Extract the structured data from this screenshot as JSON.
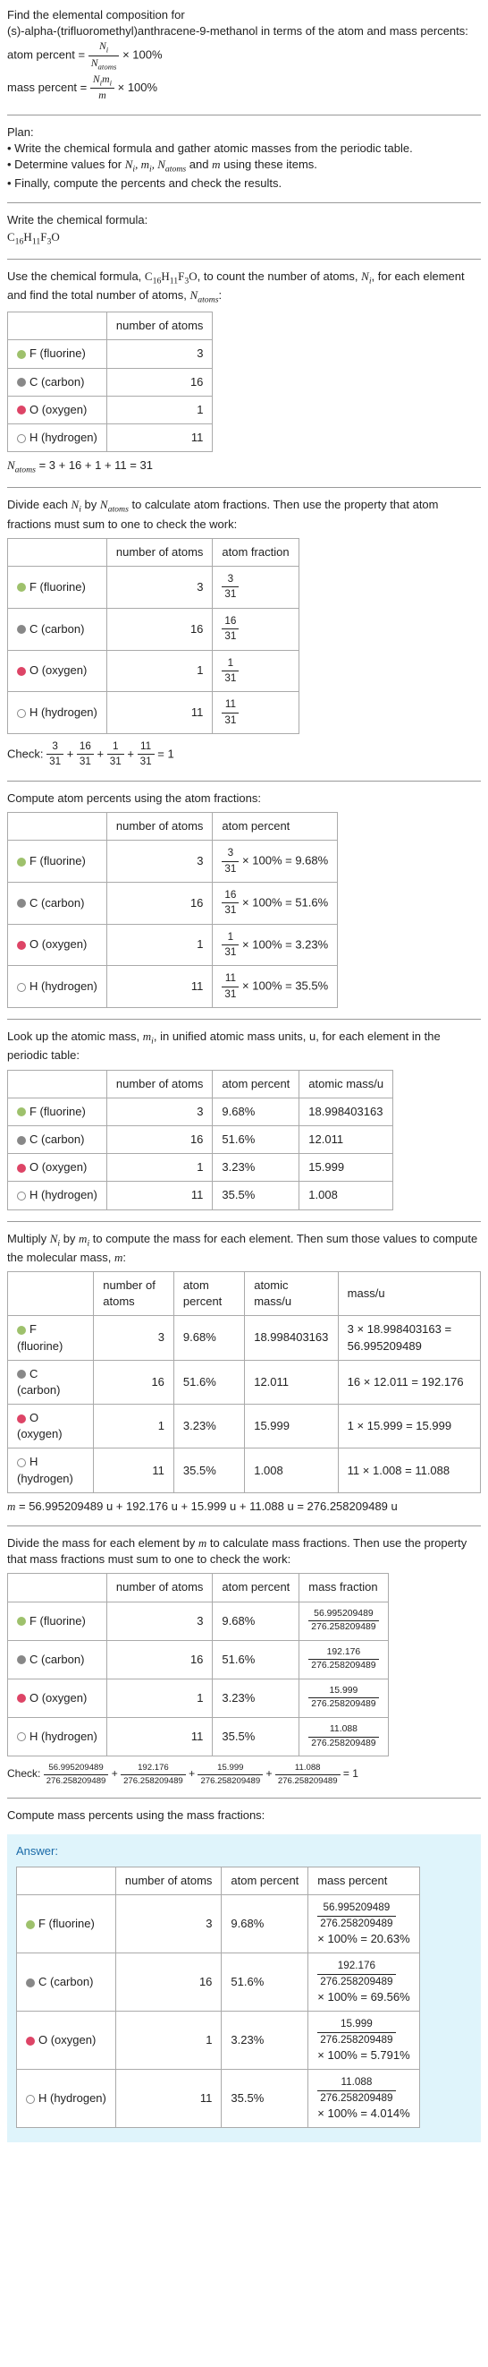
{
  "intro": {
    "title_line1": "Find the elemental composition for",
    "title_line2": "(s)-alpha-(trifluoromethyl)anthracene-9-methanol in terms of the atom and mass percents:",
    "atom_percent_label": "atom percent =",
    "atom_percent_frac_num": "N_i",
    "atom_percent_frac_den": "N_atoms",
    "times100": "× 100%",
    "mass_percent_label": "mass percent =",
    "mass_percent_frac_num": "N_i m_i",
    "mass_percent_frac_den": "m"
  },
  "plan": {
    "heading": "Plan:",
    "b1": "• Write the chemical formula and gather atomic masses from the periodic table.",
    "b2_pre": "• Determine values for ",
    "b2_items": "N_i, m_i, N_atoms and m",
    "b2_post": " using these items.",
    "b3": "• Finally, compute the percents and check the results."
  },
  "formula_section": {
    "heading": "Write the chemical formula:",
    "formula": "C₁₆H₁₁F₃O"
  },
  "count_section": {
    "text_pre": "Use the chemical formula, ",
    "text_formula": "C₁₆H₁₁F₃O",
    "text_mid": ", to count the number of atoms, ",
    "text_ni": "N_i",
    "text_post": ", for each element and find the total number of atoms, ",
    "text_natoms": "N_atoms",
    "colon": ":",
    "col_noa": "number of atoms",
    "elements": {
      "f_name": "F (fluorine)",
      "c_name": "C (carbon)",
      "o_name": "O (oxygen)",
      "h_name": "H (hydrogen)"
    },
    "n_f": "3",
    "n_c": "16",
    "n_o": "1",
    "n_h": "11",
    "natoms_line": "N_atoms = 3 + 16 + 1 + 11 = 31"
  },
  "atomfrac_section": {
    "text": "Divide each N_i by N_atoms to calculate atom fractions. Then use the property that atom fractions must sum to one to check the work:",
    "col_noa": "number of atoms",
    "col_af": "atom fraction",
    "af_f_num": "3",
    "af_f_den": "31",
    "af_c_num": "16",
    "af_c_den": "31",
    "af_o_num": "1",
    "af_o_den": "31",
    "af_h_num": "11",
    "af_h_den": "31",
    "check_label": "Check: ",
    "check_eq": " = 1"
  },
  "atompct_section": {
    "text": "Compute atom percents using the atom fractions:",
    "col_noa": "number of atoms",
    "col_ap": "atom percent",
    "ap_f": " × 100% = 9.68%",
    "ap_c": " × 100% = 51.6%",
    "ap_o": " × 100% = 3.23%",
    "ap_h": " × 100% = 35.5%"
  },
  "atomicmass_section": {
    "text_pre": "Look up the atomic mass, ",
    "text_mi": "m_i",
    "text_post": ", in unified atomic mass units, u, for each element in the periodic table:",
    "col_noa": "number of atoms",
    "col_ap": "atom percent",
    "col_am": "atomic mass/u",
    "ap_f": "9.68%",
    "ap_c": "51.6%",
    "ap_o": "3.23%",
    "ap_h": "35.5%",
    "am_f": "18.998403163",
    "am_c": "12.011",
    "am_o": "15.999",
    "am_h": "1.008"
  },
  "massmult_section": {
    "text": "Multiply N_i by m_i to compute the mass for each element. Then sum those values to compute the molecular mass, m:",
    "col_noa": "number of atoms",
    "col_ap": "atom percent",
    "col_am": "atomic mass/u",
    "col_mass": "mass/u",
    "mass_f": "3 × 18.998403163 = 56.995209489",
    "mass_c": "16 × 12.011 = 192.176",
    "mass_o": "1 × 15.999 = 15.999",
    "mass_h": "11 × 1.008 = 11.088",
    "m_line": "m = 56.995209489 u + 192.176 u + 15.999 u + 11.088 u = 276.258209489 u"
  },
  "massfrac_section": {
    "text": "Divide the mass for each element by m to calculate mass fractions. Then use the property that mass fractions must sum to one to check the work:",
    "col_noa": "number of atoms",
    "col_ap": "atom percent",
    "col_mf": "mass fraction",
    "mf_f_num": "56.995209489",
    "mf_den": "276.258209489",
    "mf_c_num": "192.176",
    "mf_o_num": "15.999",
    "mf_h_num": "11.088",
    "check_label": "Check: ",
    "check_eq": " = 1"
  },
  "masspct_section": {
    "text": "Compute mass percents using the mass fractions:"
  },
  "answer": {
    "label": "Answer:",
    "col_noa": "number of atoms",
    "col_ap": "atom percent",
    "col_mp": "mass percent",
    "mp_f_num": "56.995209489",
    "mp_den": "276.258209489",
    "mp_f_res": "× 100% = 20.63%",
    "mp_c_num": "192.176",
    "mp_c_res": "× 100% = 69.56%",
    "mp_o_num": "15.999",
    "mp_o_res": "× 100% = 5.791%",
    "mp_h_num": "11.088",
    "mp_h_res": "× 100% = 4.014%"
  },
  "chart_data": {
    "type": "table",
    "title": "Elemental composition of C16H11F3O",
    "elements": [
      {
        "element": "F (fluorine)",
        "atoms": 3,
        "atom_fraction": "3/31",
        "atom_percent": 9.68,
        "atomic_mass_u": 18.998403163,
        "mass_u": 56.995209489,
        "mass_fraction": "56.995209489/276.258209489",
        "mass_percent": 20.63
      },
      {
        "element": "C (carbon)",
        "atoms": 16,
        "atom_fraction": "16/31",
        "atom_percent": 51.6,
        "atomic_mass_u": 12.011,
        "mass_u": 192.176,
        "mass_fraction": "192.176/276.258209489",
        "mass_percent": 69.56
      },
      {
        "element": "O (oxygen)",
        "atoms": 1,
        "atom_fraction": "1/31",
        "atom_percent": 3.23,
        "atomic_mass_u": 15.999,
        "mass_u": 15.999,
        "mass_fraction": "15.999/276.258209489",
        "mass_percent": 5.791
      },
      {
        "element": "H (hydrogen)",
        "atoms": 11,
        "atom_fraction": "11/31",
        "atom_percent": 35.5,
        "atomic_mass_u": 1.008,
        "mass_u": 11.088,
        "mass_fraction": "11.088/276.258209489",
        "mass_percent": 4.014
      }
    ],
    "N_atoms": 31,
    "molecular_mass_u": 276.258209489
  }
}
